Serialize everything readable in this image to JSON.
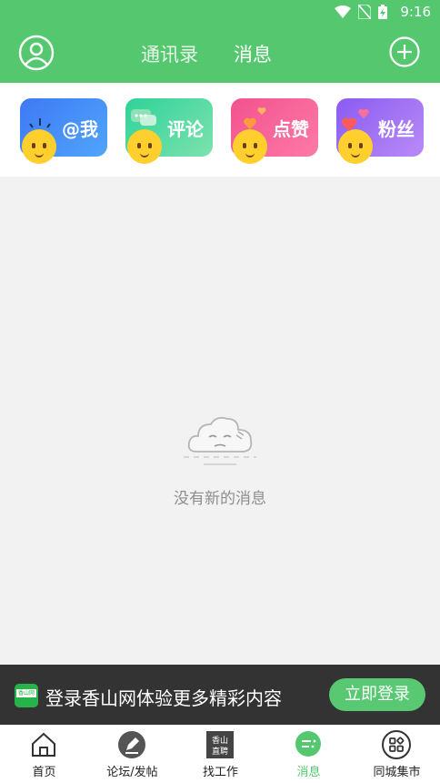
{
  "status": {
    "time": "9:16"
  },
  "header": {
    "tabs": [
      {
        "label": "通讯录"
      },
      {
        "label": "消息"
      }
    ],
    "active_tab": "消息",
    "avatar_icon": "user-avatar-icon",
    "add_icon": "plus-circle-icon"
  },
  "categories": [
    {
      "label": "@我",
      "color": "#3e78f5"
    },
    {
      "label": "评论",
      "color": "#2fd29a"
    },
    {
      "label": "点赞",
      "color": "#f2528e"
    },
    {
      "label": "粉丝",
      "color": "#8a5bf1"
    }
  ],
  "empty_state": {
    "text": "没有新的消息",
    "icon": "sleepy-cloud-icon"
  },
  "login_banner": {
    "logo_text": "香山网",
    "text": "登录香山网体验更多精彩内容",
    "button": "立即登录"
  },
  "nav": [
    {
      "label": "首页",
      "icon": "home-icon"
    },
    {
      "label": "论坛/发帖",
      "icon": "pencil-icon"
    },
    {
      "label": "找工作",
      "icon": "job-icon",
      "icon_text_1": "香山",
      "icon_text_2": "直聘"
    },
    {
      "label": "消息",
      "icon": "message-icon",
      "active": true
    },
    {
      "label": "同城集市",
      "icon": "apps-icon"
    }
  ],
  "colors": {
    "primary": "#55c86f",
    "banner_bg": "#333333"
  }
}
